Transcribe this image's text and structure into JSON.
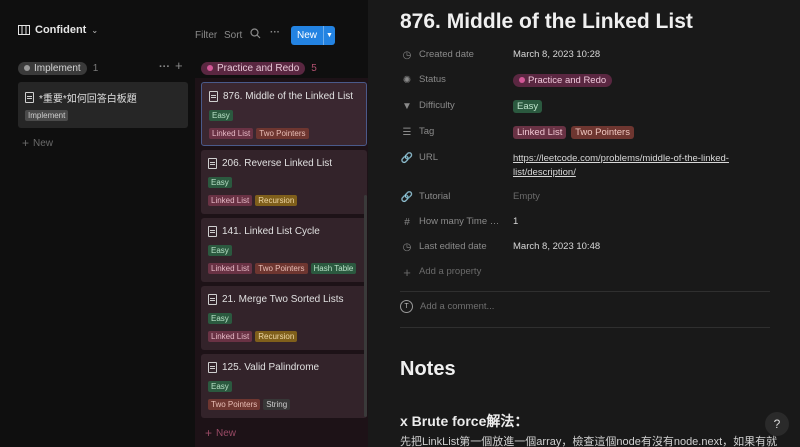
{
  "toolbar": {
    "view_label": "Confident",
    "filter": "Filter",
    "sort": "Sort",
    "more": "···",
    "new_label": "New"
  },
  "columns": [
    {
      "name": "Implement",
      "count": "1",
      "color": "#5a5a5a",
      "cards": [
        {
          "title": "*重要*如何回答白板題",
          "tags": [
            {
              "label": "Implement",
              "color": "#5a5a5a"
            }
          ]
        }
      ],
      "add_new": "New"
    },
    {
      "name": "Practice and Redo",
      "count": "5",
      "color": "#7a2f52",
      "cards": [
        {
          "title": "876. Middle of the Linked List",
          "tags": [
            {
              "label": "Easy",
              "color": "#2b593f"
            }
          ],
          "tags2": [
            {
              "label": "Linked List",
              "color": "#693244"
            },
            {
              "label": "Two Pointers",
              "color": "#6e3630"
            }
          ]
        },
        {
          "title": "206. Reverse Linked List",
          "tags": [
            {
              "label": "Easy",
              "color": "#2b593f"
            }
          ],
          "tags2": [
            {
              "label": "Linked List",
              "color": "#693244"
            },
            {
              "label": "Recursion",
              "color": "#7f5f1b"
            }
          ]
        },
        {
          "title": "141. Linked List Cycle",
          "tags": [
            {
              "label": "Easy",
              "color": "#2b593f"
            }
          ],
          "tags2": [
            {
              "label": "Linked List",
              "color": "#693244"
            },
            {
              "label": "Two Pointers",
              "color": "#6e3630"
            },
            {
              "label": "Hash Table",
              "color": "#2b593f"
            }
          ]
        },
        {
          "title": "21. Merge Two Sorted Lists",
          "tags": [
            {
              "label": "Easy",
              "color": "#2b593f"
            }
          ],
          "tags2": [
            {
              "label": "Linked List",
              "color": "#693244"
            },
            {
              "label": "Recursion",
              "color": "#7f5f1b"
            }
          ]
        },
        {
          "title": "125. Valid Palindrome",
          "tags": [
            {
              "label": "Easy",
              "color": "#2b593f"
            }
          ],
          "tags2": [
            {
              "label": "Two Pointers",
              "color": "#6e3630"
            },
            {
              "label": "String",
              "color": "#373737"
            }
          ]
        }
      ],
      "add_new": "New"
    }
  ],
  "page": {
    "title": "876. Middle of the Linked List",
    "properties": {
      "created_date": {
        "name": "Created date",
        "value": "March 8, 2023 10:28"
      },
      "status": {
        "name": "Status",
        "value": "Practice and Redo",
        "color": "#7a2f52"
      },
      "difficulty": {
        "name": "Difficulty",
        "value": "Easy",
        "color": "#2b593f"
      },
      "tag": {
        "name": "Tag",
        "values": [
          "Linked List",
          "Two Pointers"
        ]
      },
      "url": {
        "name": "URL",
        "line1": "https://leetcode.com/problems/middle-of-the-linked-",
        "line2": "list/description/"
      },
      "tutorial": {
        "name": "Tutorial",
        "value": "Empty"
      },
      "how_many": {
        "name": "How many Time …",
        "value": "1"
      },
      "last_edited": {
        "name": "Last edited date",
        "value": "March 8, 2023 10:48"
      },
      "add_property": "Add a property"
    },
    "comment_placeholder": "Add a comment...",
    "avatar_letter": "T",
    "notes_heading": "Notes",
    "sub_heading": "x Brute force解法：",
    "body_text": "先把LinkList第一個放進一個array，檢查這個node有沒有node.next，如果有就"
  },
  "help_label": "?"
}
